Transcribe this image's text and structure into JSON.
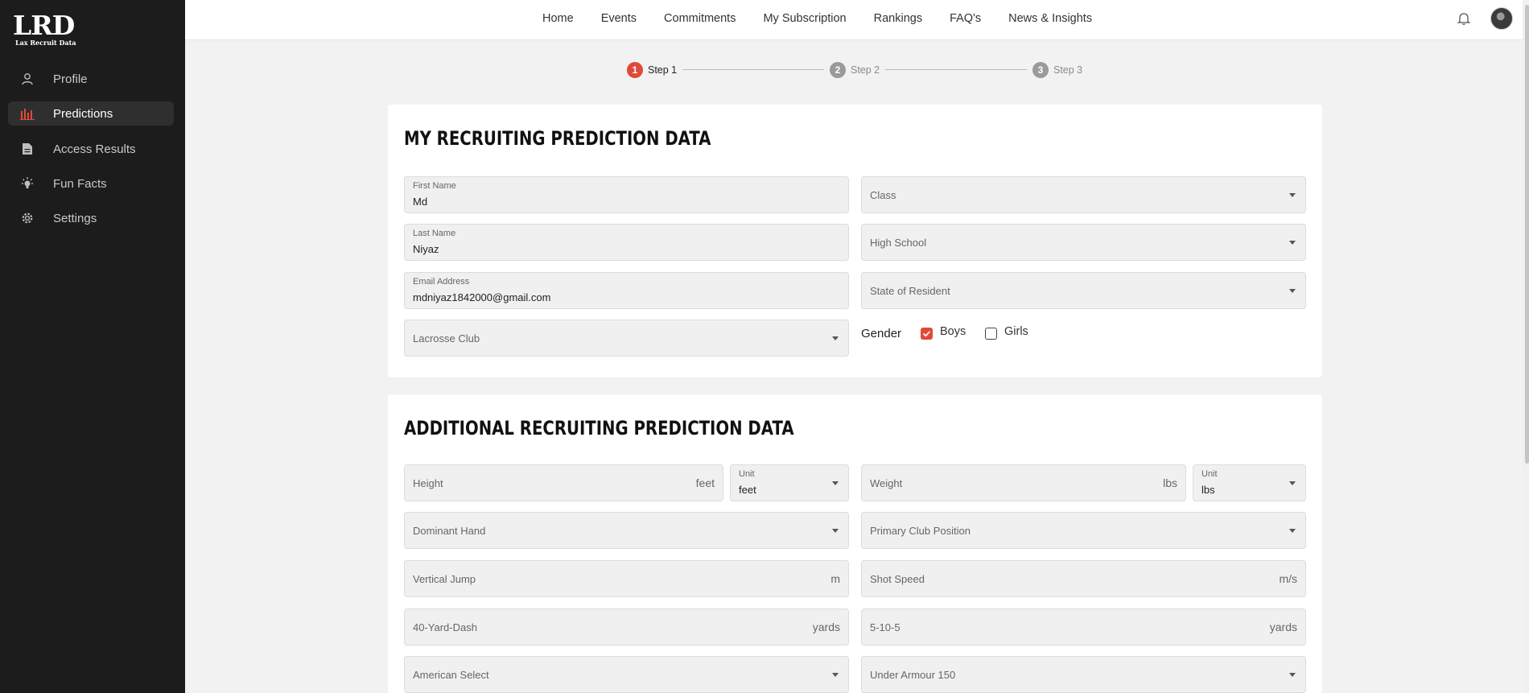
{
  "brand": {
    "logo_main": "LRD",
    "logo_sub": "Lax Recruit Data"
  },
  "sidebar": {
    "items": [
      {
        "label": "Profile",
        "icon": "user-icon",
        "active": false
      },
      {
        "label": "Predictions",
        "icon": "bar-chart-icon",
        "active": true
      },
      {
        "label": "Access Results",
        "icon": "document-icon",
        "active": false
      },
      {
        "label": "Fun Facts",
        "icon": "lightbulb-icon",
        "active": false
      },
      {
        "label": "Settings",
        "icon": "gear-icon",
        "active": false
      }
    ]
  },
  "topnav": {
    "items": [
      "Home",
      "Events",
      "Commitments",
      "My Subscription",
      "Rankings",
      "FAQ's",
      "News & Insights"
    ]
  },
  "stepper": {
    "steps": [
      {
        "num": "1",
        "label": "Step 1"
      },
      {
        "num": "2",
        "label": "Step 2"
      },
      {
        "num": "3",
        "label": "Step 3"
      }
    ]
  },
  "section1": {
    "title": "MY RECRUITING PREDICTION DATA",
    "first_name": {
      "label": "First Name",
      "value": "Md"
    },
    "last_name": {
      "label": "Last Name",
      "value": "Niyaz"
    },
    "email": {
      "label": "Email Address",
      "value": "mdniyaz1842000@gmail.com"
    },
    "lacrosse_club": "Lacrosse Club",
    "class": "Class",
    "high_school": "High School",
    "state": "State of Resident",
    "gender": {
      "label": "Gender",
      "boys": "Boys",
      "girls": "Girls",
      "boys_checked": true,
      "girls_checked": false
    }
  },
  "section2": {
    "title": "ADDITIONAL RECRUITING PREDICTION DATA",
    "height": {
      "placeholder": "Height",
      "unit": "feet"
    },
    "height_unit": {
      "label": "Unit",
      "value": "feet"
    },
    "weight": {
      "placeholder": "Weight",
      "unit": "lbs"
    },
    "weight_unit": {
      "label": "Unit",
      "value": "lbs"
    },
    "dominant_hand": "Dominant Hand",
    "primary_position": "Primary Club Position",
    "vertical_jump": {
      "placeholder": "Vertical Jump",
      "unit": "m"
    },
    "shot_speed": {
      "placeholder": "Shot Speed",
      "unit": "m/s"
    },
    "dash": {
      "placeholder": "40-Yard-Dash",
      "unit": "yards"
    },
    "five_ten_five": {
      "placeholder": "5-10-5",
      "unit": "yards"
    },
    "american_select": "American Select",
    "under_armour": "Under Armour 150"
  },
  "colors": {
    "accent": "#e04a3a",
    "sidebar_bg": "#1c1c1c"
  }
}
